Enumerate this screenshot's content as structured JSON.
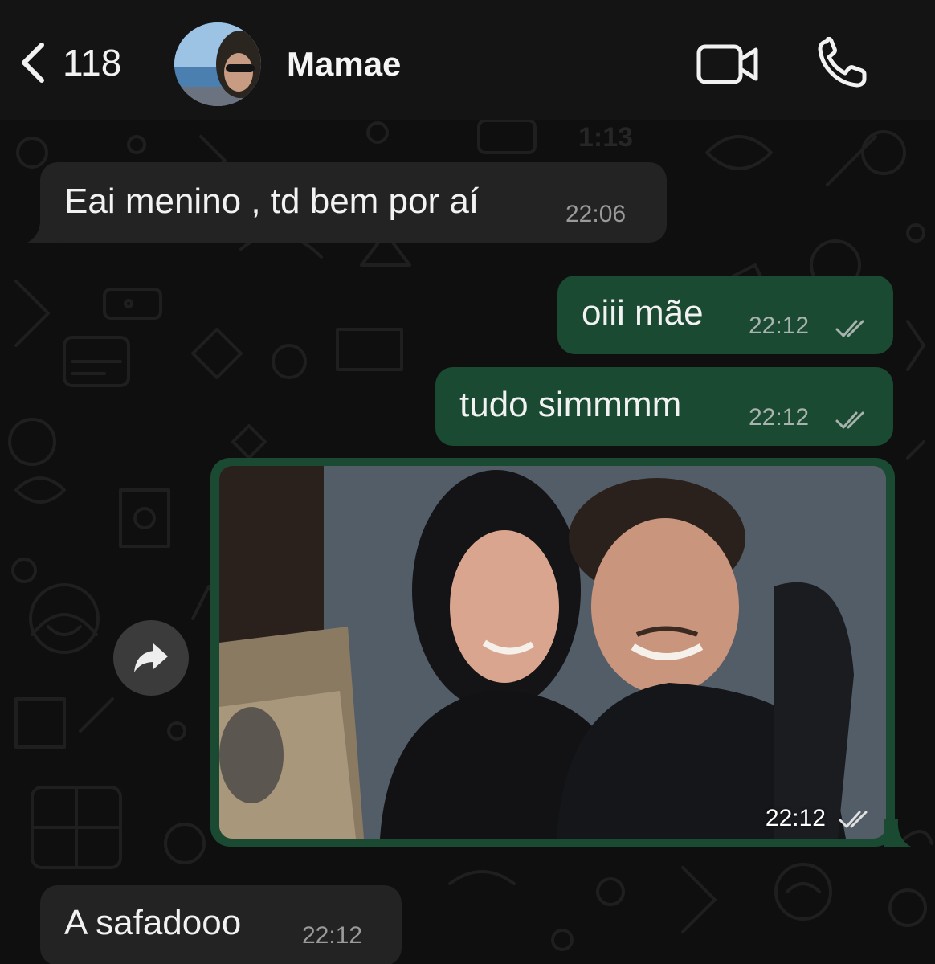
{
  "header": {
    "unread_count": "118",
    "contact_name": "Mamae",
    "icons": {
      "back": "chevron-left-icon",
      "video": "video-camera-icon",
      "call": "phone-icon"
    }
  },
  "messages": [
    {
      "direction": "incoming",
      "text": "Eai menino , td bem por aí",
      "time": "22:06"
    },
    {
      "direction": "outgoing",
      "text": "oiii mãe",
      "time": "22:12",
      "status": "read"
    },
    {
      "direction": "outgoing",
      "text": "tudo simmmm",
      "time": "22:12",
      "status": "read"
    },
    {
      "direction": "outgoing",
      "type": "photo",
      "time": "22:12",
      "status": "read"
    },
    {
      "direction": "incoming",
      "text": "A safadooo",
      "time": "22:12"
    }
  ],
  "wallpaper_stamp": "1:13",
  "colors": {
    "incoming_bubble": "#232323",
    "outgoing_bubble": "#1b4a33",
    "background": "#0f0f0f",
    "header": "#141414"
  }
}
